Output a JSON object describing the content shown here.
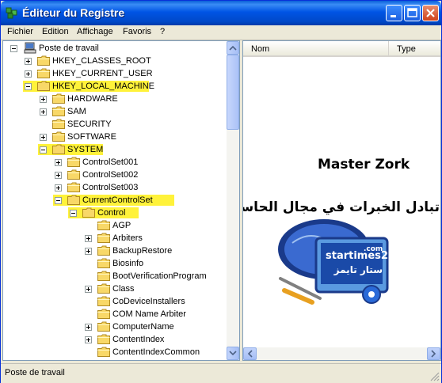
{
  "window": {
    "title": "Éditeur du Registre"
  },
  "menu": {
    "items": [
      "Fichier",
      "Edition",
      "Affichage",
      "Favoris",
      "?"
    ]
  },
  "tree": {
    "root": "Poste de travail",
    "items": [
      {
        "label": "HKEY_CLASSES_ROOT",
        "level": 1,
        "expander": "plus",
        "highlighted": false
      },
      {
        "label": "HKEY_CURRENT_USER",
        "level": 1,
        "expander": "plus",
        "highlighted": false
      },
      {
        "label": "HKEY_LOCAL_MACHINE",
        "level": 1,
        "expander": "minus",
        "highlighted": true
      },
      {
        "label": "HARDWARE",
        "level": 2,
        "expander": "plus",
        "highlighted": false
      },
      {
        "label": "SAM",
        "level": 2,
        "expander": "plus",
        "highlighted": false
      },
      {
        "label": "SECURITY",
        "level": 2,
        "expander": "none",
        "highlighted": false
      },
      {
        "label": "SOFTWARE",
        "level": 2,
        "expander": "plus",
        "highlighted": false
      },
      {
        "label": "SYSTEM",
        "level": 2,
        "expander": "minus",
        "highlighted": true
      },
      {
        "label": "ControlSet001",
        "level": 3,
        "expander": "plus",
        "highlighted": false
      },
      {
        "label": "ControlSet002",
        "level": 3,
        "expander": "plus",
        "highlighted": false
      },
      {
        "label": "ControlSet003",
        "level": 3,
        "expander": "plus",
        "highlighted": false
      },
      {
        "label": "CurrentControlSet",
        "level": 3,
        "expander": "minus",
        "highlighted": true
      },
      {
        "label": "Control",
        "level": 4,
        "expander": "minus",
        "highlighted": true
      },
      {
        "label": "AGP",
        "level": 5,
        "expander": "none",
        "highlighted": false
      },
      {
        "label": "Arbiters",
        "level": 5,
        "expander": "plus",
        "highlighted": false
      },
      {
        "label": "BackupRestore",
        "level": 5,
        "expander": "plus",
        "highlighted": false
      },
      {
        "label": "Biosinfo",
        "level": 5,
        "expander": "none",
        "highlighted": false
      },
      {
        "label": "BootVerificationProgram",
        "level": 5,
        "expander": "none",
        "highlighted": false
      },
      {
        "label": "Class",
        "level": 5,
        "expander": "plus",
        "highlighted": false
      },
      {
        "label": "CoDeviceInstallers",
        "level": 5,
        "expander": "none",
        "highlighted": false
      },
      {
        "label": "COM Name Arbiter",
        "level": 5,
        "expander": "none",
        "highlighted": false
      },
      {
        "label": "ComputerName",
        "level": 5,
        "expander": "plus",
        "highlighted": false
      },
      {
        "label": "ContentIndex",
        "level": 5,
        "expander": "plus",
        "highlighted": false
      },
      {
        "label": "ContentIndexCommon",
        "level": 5,
        "expander": "none",
        "highlighted": false
      }
    ]
  },
  "list": {
    "columns": [
      "Nom",
      "Type"
    ]
  },
  "watermark": {
    "heading": "Master Zork",
    "arabic_text": "تبادل الخبرات في مجال الحاسب",
    "site": "startimes2",
    "site_suffix": ".com",
    "arabic_name": "ستار تايمز"
  },
  "status": {
    "text": "Poste de travail"
  },
  "colors": {
    "highlight": "#fff23a",
    "folder": "#f8d868",
    "titlebar": "#0055e5"
  }
}
